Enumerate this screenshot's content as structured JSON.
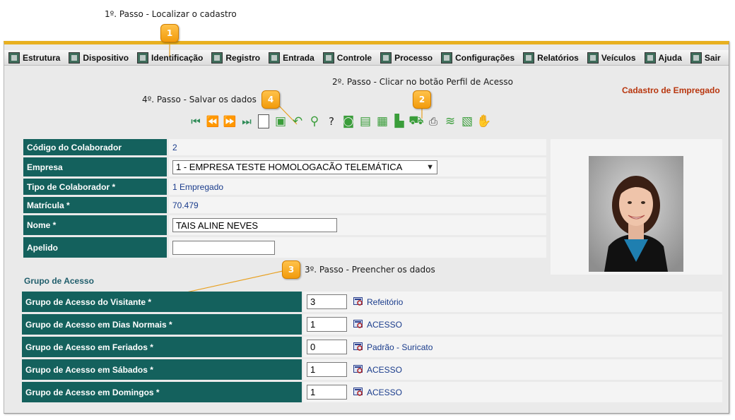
{
  "annotations": {
    "step1": "1º. Passo - Localizar o cadastro",
    "step2": "2º. Passo - Clicar no botão Perfil de Acesso",
    "step3": "3º. Passo - Preencher os dados",
    "step4": "4º. Passo - Salvar os dados",
    "badges": [
      "1",
      "2",
      "3",
      "4"
    ]
  },
  "menu": [
    {
      "label": "Estrutura",
      "icon": "structure-icon"
    },
    {
      "label": "Dispositivo",
      "icon": "device-icon"
    },
    {
      "label": "Identificação",
      "icon": "identification-icon"
    },
    {
      "label": "Registro",
      "icon": "record-icon"
    },
    {
      "label": "Entrada",
      "icon": "entry-icon"
    },
    {
      "label": "Controle",
      "icon": "control-icon"
    },
    {
      "label": "Processo",
      "icon": "process-icon"
    },
    {
      "label": "Configurações",
      "icon": "settings-icon"
    },
    {
      "label": "Relatórios",
      "icon": "reports-icon"
    },
    {
      "label": "Veículos",
      "icon": "vehicles-icon"
    },
    {
      "label": "Ajuda",
      "icon": "help-icon"
    },
    {
      "label": "Sair",
      "icon": "exit-icon"
    }
  ],
  "page_title": "Cadastro de Empregado",
  "toolbar_icons": [
    "first-record-icon",
    "previous-record-icon",
    "next-record-icon",
    "last-record-icon",
    "new-document-icon",
    "save-icon",
    "undo-icon",
    "search-icon",
    "help-icon",
    "photo-icon",
    "access-profile-icon",
    "document-icon",
    "hierarchy-icon",
    "vehicle-icon",
    "printer-icon",
    "biometric-icon",
    "badge-icon",
    "hand-icon"
  ],
  "form": {
    "codigo_label": "Código do Colaborador",
    "codigo_value": "2",
    "empresa_label": "Empresa",
    "empresa_value": "1 - EMPRESA TESTE HOMOLOGACÃO TELEMÁTICA",
    "tipo_label": "Tipo de Colaborador *",
    "tipo_value": "1 Empregado",
    "matricula_label": "Matrícula *",
    "matricula_value": "70.479",
    "nome_label": "Nome *",
    "nome_value": "TAIS ALINE NEVES",
    "apelido_label": "Apelido",
    "apelido_value": ""
  },
  "access_group": {
    "section_title": "Grupo de Acesso",
    "rows": [
      {
        "label": "Grupo de Acesso do Visitante *",
        "value": "3",
        "link": "Refeitório"
      },
      {
        "label": "Grupo de Acesso em Dias Normais *",
        "value": "1",
        "link": "ACESSO"
      },
      {
        "label": "Grupo de Acesso em Feriados *",
        "value": "0",
        "link": "Padrão - Suricato"
      },
      {
        "label": "Grupo de Acesso em Sábados *",
        "value": "1",
        "link": "ACESSO"
      },
      {
        "label": "Grupo de Acesso em Domingos *",
        "value": "1",
        "link": "ACESSO"
      }
    ]
  },
  "colors": {
    "accent": "#e8b020",
    "label_bg": "#14615d",
    "title": "#b8360e",
    "link": "#1a3c8c"
  }
}
